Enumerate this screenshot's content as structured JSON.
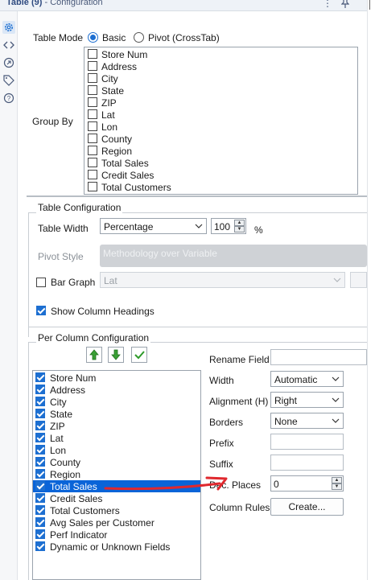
{
  "header": {
    "title_main": "Table (9)",
    "title_sub": " - Configuration",
    "more_icon": "more-vertical-icon",
    "pin_icon": "pin-icon"
  },
  "sidebar": {
    "icons": [
      "gear-icon",
      "code-icon",
      "link-icon",
      "tag-icon",
      "help-icon"
    ]
  },
  "table_mode": {
    "label": "Table Mode",
    "options": [
      {
        "label": "Basic",
        "selected": true
      },
      {
        "label": "Pivot (CrossTab)",
        "selected": false
      }
    ]
  },
  "group_by": {
    "label": "Group By",
    "items": [
      {
        "label": "Store Num",
        "checked": false
      },
      {
        "label": "Address",
        "checked": false
      },
      {
        "label": "City",
        "checked": false
      },
      {
        "label": "State",
        "checked": false
      },
      {
        "label": "ZIP",
        "checked": false
      },
      {
        "label": "Lat",
        "checked": false
      },
      {
        "label": "Lon",
        "checked": false
      },
      {
        "label": "County",
        "checked": false
      },
      {
        "label": "Region",
        "checked": false
      },
      {
        "label": "Total Sales",
        "checked": false
      },
      {
        "label": "Credit Sales",
        "checked": false
      },
      {
        "label": "Total Customers",
        "checked": false
      }
    ]
  },
  "table_config": {
    "title": "Table Configuration",
    "width_label": "Table Width",
    "width_mode": "Percentage",
    "width_value": "100",
    "width_unit": "%",
    "pivot_style_label": "Pivot Style",
    "pivot_style_value": "Methodology over Variable",
    "bar_graph_label": "Bar Graph",
    "bar_graph_checked": false,
    "bar_graph_field": "Lat",
    "show_headings_label": "Show Column Headings",
    "show_headings_checked": true
  },
  "per_column": {
    "title": "Per Column Configuration",
    "move_up_icon": "arrow-up-icon",
    "move_down_icon": "arrow-down-icon",
    "check_all_icon": "checkmark-icon",
    "columns": [
      {
        "label": "Store Num",
        "checked": true,
        "selected": false
      },
      {
        "label": "Address",
        "checked": true,
        "selected": false
      },
      {
        "label": "City",
        "checked": true,
        "selected": false
      },
      {
        "label": "State",
        "checked": true,
        "selected": false
      },
      {
        "label": "ZIP",
        "checked": true,
        "selected": false
      },
      {
        "label": "Lat",
        "checked": true,
        "selected": false
      },
      {
        "label": "Lon",
        "checked": true,
        "selected": false
      },
      {
        "label": "County",
        "checked": true,
        "selected": false
      },
      {
        "label": "Region",
        "checked": true,
        "selected": false
      },
      {
        "label": "Total Sales",
        "checked": true,
        "selected": true
      },
      {
        "label": "Credit Sales",
        "checked": true,
        "selected": false
      },
      {
        "label": "Total Customers",
        "checked": true,
        "selected": false
      },
      {
        "label": "Avg Sales per Customer",
        "checked": true,
        "selected": false
      },
      {
        "label": "Perf Indicator",
        "checked": true,
        "selected": false
      },
      {
        "label": "Dynamic or Unknown Fields",
        "checked": true,
        "selected": false
      }
    ],
    "rename_label": "Rename Field",
    "rename_value": "",
    "width_label": "Width",
    "width_value": "Automatic",
    "alignment_label": "Alignment (H)",
    "alignment_value": "Right",
    "borders_label": "Borders",
    "borders_value": "None",
    "prefix_label": "Prefix",
    "prefix_value": "",
    "suffix_label": "Suffix",
    "suffix_value": "",
    "dec_places_label": "Dec. Places",
    "dec_places_value": "0",
    "column_rules_label": "Column Rules",
    "create_button": "Create..."
  },
  "annotation_color": "#e0282e",
  "accent_color": "#1d6fd1"
}
